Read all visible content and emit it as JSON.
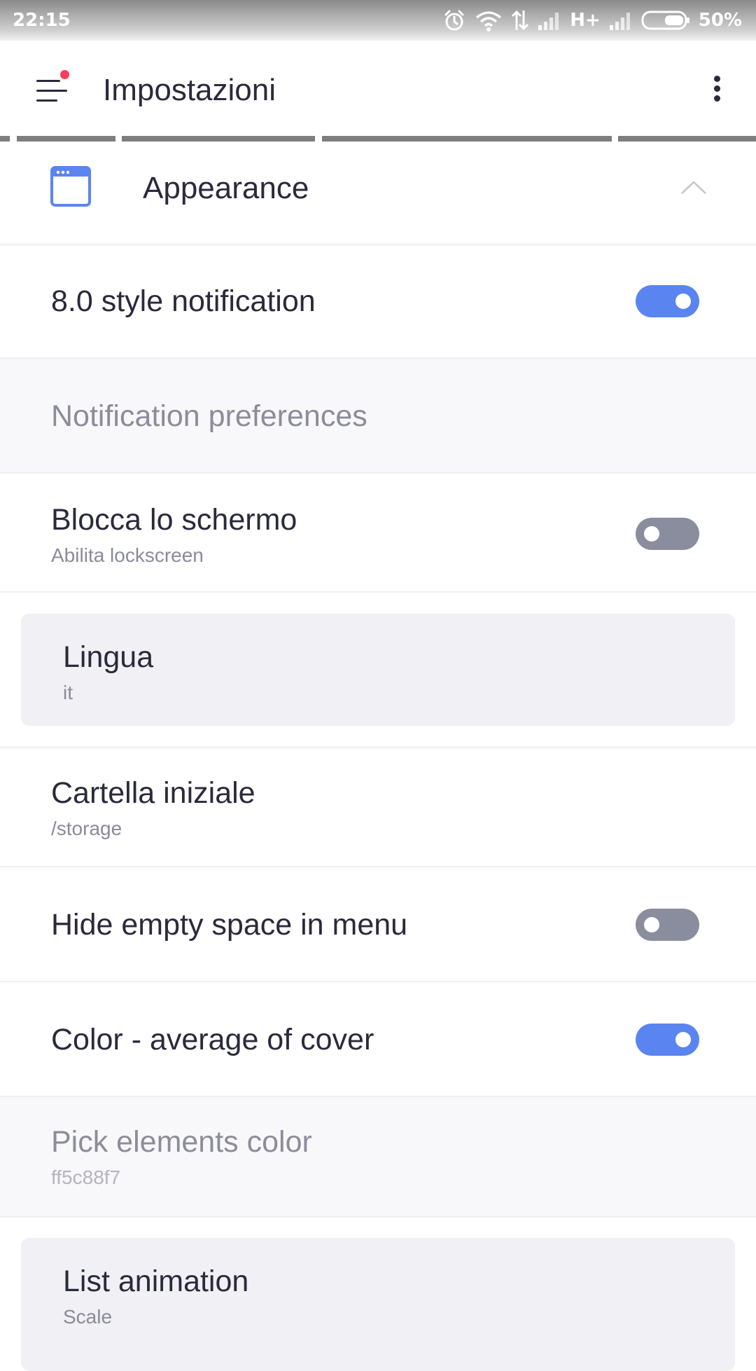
{
  "status_bar": {
    "time": "22:15",
    "network": "H+",
    "battery": "50%",
    "icons": [
      "alarm-icon",
      "wifi-icon",
      "data-transfer-icon",
      "signal-icon",
      "signal-icon",
      "battery-icon"
    ]
  },
  "app_bar": {
    "title": "Impostazioni",
    "menu_icon": "hamburger-menu-icon",
    "more_icon": "more-vertical-icon"
  },
  "section": {
    "title": "Appearance",
    "icon": "browser-window-icon",
    "expanded": true
  },
  "settings": [
    {
      "title": "8.0 style notification",
      "type": "toggle",
      "on": true
    },
    {
      "title": "Notification preferences",
      "type": "category",
      "enabled": false
    },
    {
      "title": "Blocca lo schermo",
      "subtitle": "Abilita lockscreen",
      "type": "toggle",
      "on": false
    },
    {
      "title": "Lingua",
      "subtitle": "it",
      "type": "select"
    },
    {
      "title": "Cartella iniziale",
      "subtitle": "/storage",
      "type": "select"
    },
    {
      "title": "Hide empty space in menu",
      "type": "toggle",
      "on": false
    },
    {
      "title": "Color - average of cover",
      "type": "toggle",
      "on": true
    },
    {
      "title": "Pick elements color",
      "subtitle": "ff5c88f7",
      "type": "color",
      "enabled": false
    },
    {
      "title": "List animation",
      "subtitle": "Scale",
      "type": "select"
    }
  ],
  "colors": {
    "accent": "#5a84f0",
    "toggle_off": "#8a8d9e",
    "badge": "#ff3b5c",
    "text_primary": "#2a2a3c",
    "text_secondary": "#8b8b98",
    "card_bg": "#f0f0f5",
    "section_icon": "#5a84f0"
  }
}
